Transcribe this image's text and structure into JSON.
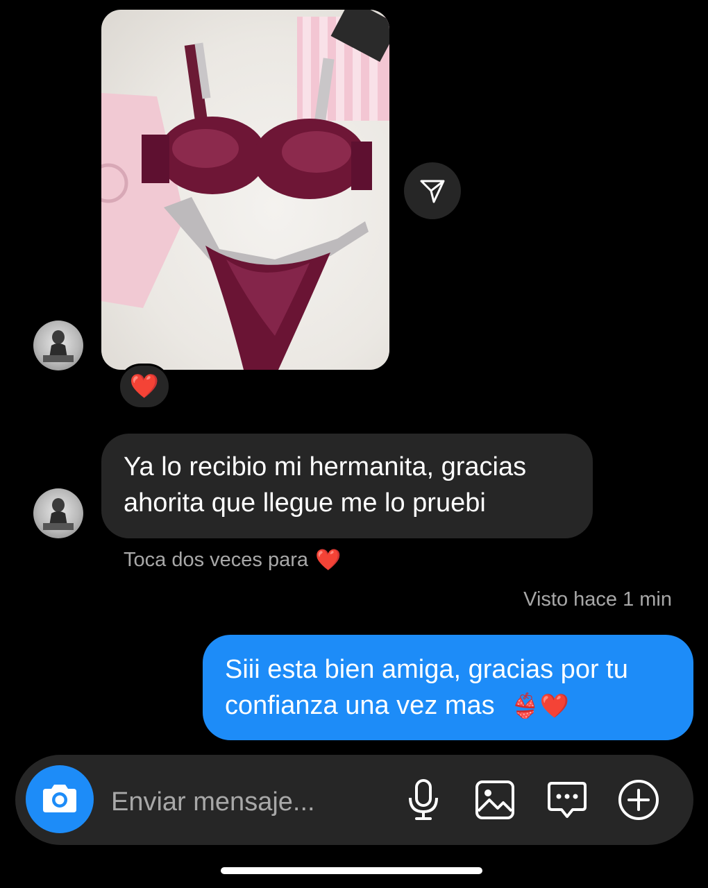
{
  "thread": {
    "reaction_emoji": "❤️",
    "incoming_message": {
      "line1": "Ya lo recibio mi hermanita, gracias",
      "line2": "ahorita que llegue me lo pruebi"
    },
    "double_tap_hint": "Toca dos veces para",
    "hint_emoji": "❤️",
    "seen_status": "Visto hace 1 min",
    "outgoing_message": {
      "line1": "Siii esta bien amiga, gracias por tu",
      "line2": "confianza una vez mas",
      "emojis": "👙❤️"
    }
  },
  "composer": {
    "placeholder": "Enviar mensaje...",
    "icons": [
      "camera-icon",
      "microphone-icon",
      "gallery-icon",
      "sticker-icon",
      "plus-icon"
    ]
  },
  "colors": {
    "background": "#000000",
    "incoming_bubble": "#262626",
    "outgoing_bubble": "#1d8cf8",
    "secondary_text": "#a8a8a8"
  }
}
